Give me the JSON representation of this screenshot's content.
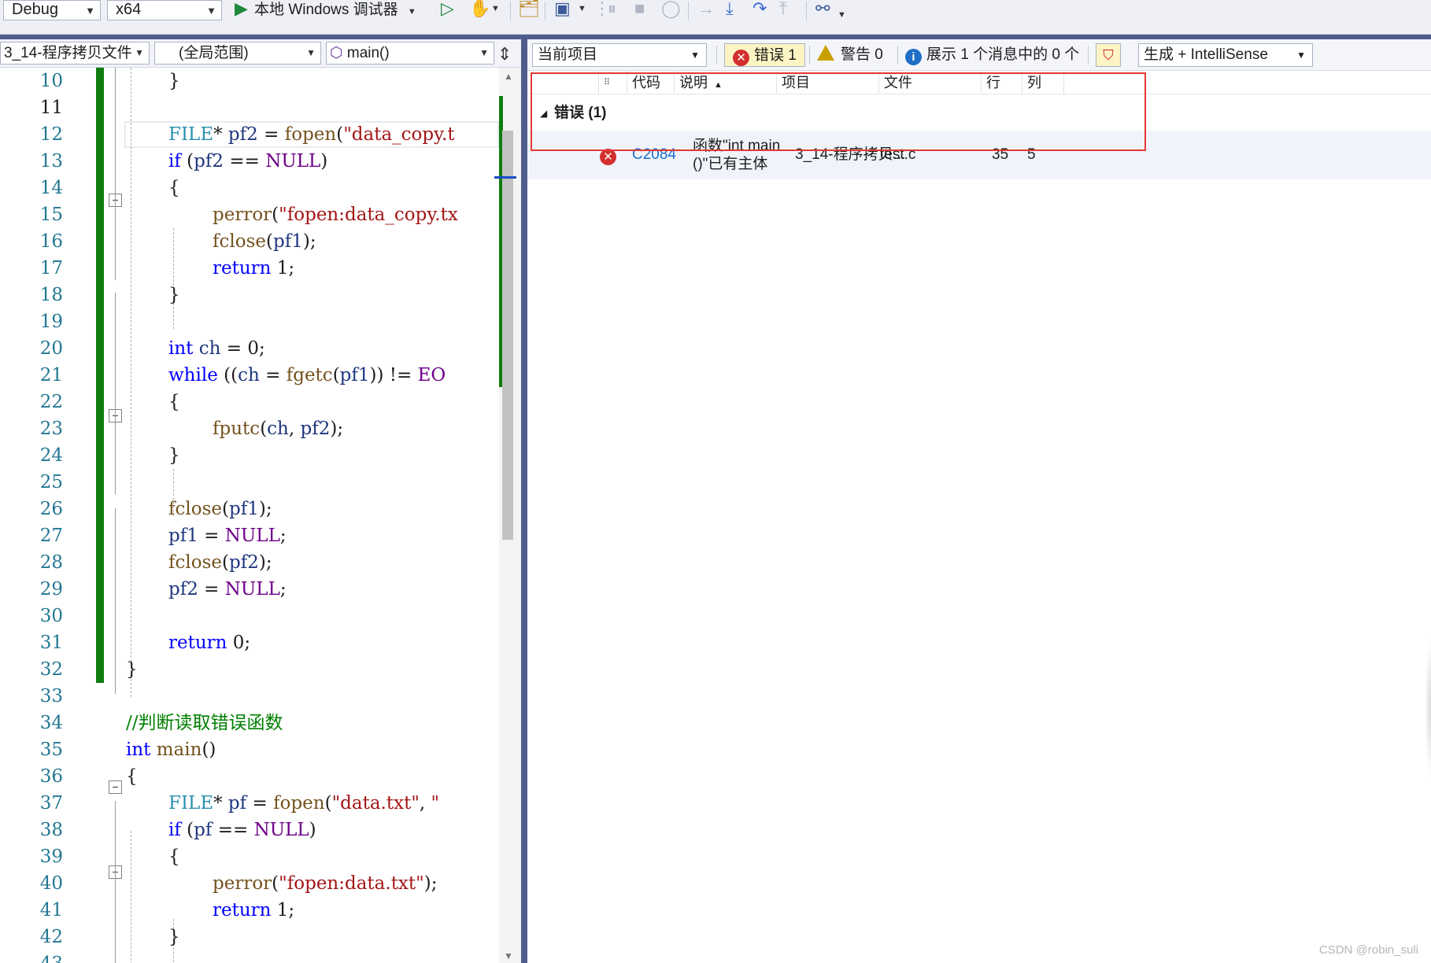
{
  "toolbar": {
    "config": "Debug",
    "platform": "x64",
    "run_label": "本地 Windows 调试器"
  },
  "editor": {
    "nav": {
      "project": "3_14-程序拷贝文件",
      "scope": "(全局范围)",
      "member": "main()"
    },
    "current_line": "11"
  },
  "error_list": {
    "scope": "当前项目",
    "errors_btn": "错误 1",
    "warnings_btn": "警告 0",
    "messages_btn": "展示 1 个消息中的 0 个",
    "source": "生成 + IntelliSense",
    "columns": [
      "代码",
      "说明",
      "项目",
      "文件",
      "行",
      "列"
    ],
    "group_label": "错误 (1)",
    "rows": [
      {
        "code": "C2084",
        "description": "函数\"int main ()\"已有主体",
        "project": "3_14-程序拷贝...",
        "file": "test.c",
        "line": "35",
        "column": "5"
      }
    ]
  },
  "watermark": "CSDN @robin_suli"
}
